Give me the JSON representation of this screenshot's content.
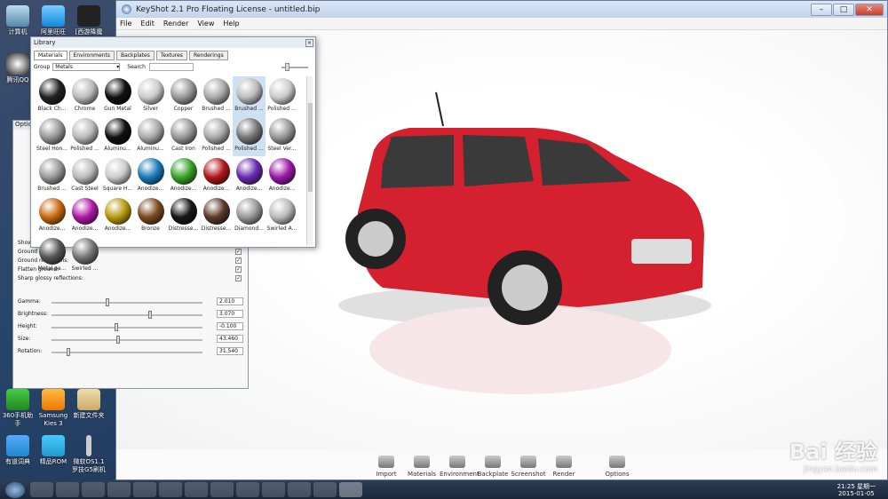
{
  "desktop": {
    "icons": [
      {
        "label": "计算机"
      },
      {
        "label": "阿里旺旺"
      },
      {
        "label": "[西游降魔篇]"
      },
      {
        "label": "腾讯QQ"
      },
      {
        "label": "360手机助手"
      },
      {
        "label": "Samsung Kies 3"
      },
      {
        "label": "新建文件夹"
      },
      {
        "label": "有道词典"
      },
      {
        "label": "精品ROM"
      },
      {
        "label": "微软OS1.1 罗技G5刷机"
      }
    ]
  },
  "window": {
    "title": "KeyShot 2.1 Pro Floating License - untitled.bip",
    "close": "✕"
  },
  "menu": [
    "File",
    "Edit",
    "Render",
    "View",
    "Help"
  ],
  "library": {
    "title": "Library",
    "tabs": [
      "Materials",
      "Environments",
      "Backplates",
      "Textures",
      "Renderings"
    ],
    "group_label": "Group",
    "group_value": "Metals",
    "search_label": "Search",
    "items": [
      {
        "name": "Black Ch...",
        "c": "#222"
      },
      {
        "name": "Chrome",
        "c": "#bbb"
      },
      {
        "name": "Gun Metal",
        "c": "#111"
      },
      {
        "name": "Silver",
        "c": "#ccc"
      },
      {
        "name": "Copper",
        "c": "#999"
      },
      {
        "name": "Brushed ...",
        "c": "#aaa"
      },
      {
        "name": "Brushed ...",
        "c": "#bbb",
        "hl": true
      },
      {
        "name": "Polished ...",
        "c": "#ccc"
      },
      {
        "name": "Steel Hon...",
        "c": "#999"
      },
      {
        "name": "Polished ...",
        "c": "#bbb"
      },
      {
        "name": "Aluminu...",
        "c": "#111"
      },
      {
        "name": "Aluminu...",
        "c": "#aaa"
      },
      {
        "name": "Cast Iron",
        "c": "#999"
      },
      {
        "name": "Polished ...",
        "c": "#aaa"
      },
      {
        "name": "Polished ...",
        "c": "#777",
        "hl": true
      },
      {
        "name": "Steel Ver...",
        "c": "#999"
      },
      {
        "name": "Brushed ...",
        "c": "#999"
      },
      {
        "name": "Cast Steel",
        "c": "#bbb"
      },
      {
        "name": "Square H...",
        "c": "#ccc"
      },
      {
        "name": "Anodize...",
        "c": "#1a7ab8"
      },
      {
        "name": "Anodize...",
        "c": "#3aa22a"
      },
      {
        "name": "Anodize...",
        "c": "#b01818"
      },
      {
        "name": "Anodize...",
        "c": "#6a2ab0"
      },
      {
        "name": "Anodize...",
        "c": "#9a1aa8"
      },
      {
        "name": "Anodize...",
        "c": "#c76a10"
      },
      {
        "name": "Anodize...",
        "c": "#b01aa8"
      },
      {
        "name": "Anodize...",
        "c": "#b89a10"
      },
      {
        "name": "Bronze",
        "c": "#7a4a22"
      },
      {
        "name": "Distresse...",
        "c": "#181818"
      },
      {
        "name": "Distresse...",
        "c": "#5a3a2a"
      },
      {
        "name": "Diamond...",
        "c": "#999"
      },
      {
        "name": "Swirled A...",
        "c": "#bbb"
      },
      {
        "name": "Metal pa...",
        "c": "#555"
      },
      {
        "name": "Swirled ...",
        "c": "#777"
      }
    ]
  },
  "options": {
    "title": "Optio",
    "checks": [
      {
        "label": "Show environment:",
        "checked": ""
      },
      {
        "label": "Ground shadows:",
        "checked": "✓"
      },
      {
        "label": "Ground reflections:",
        "checked": "✓"
      },
      {
        "label": "Flatten ground:",
        "checked": "✓"
      },
      {
        "label": "Sharp glossy reflections:",
        "checked": "✓"
      }
    ],
    "sliders": [
      {
        "label": "Gamma:",
        "value": "2.010",
        "pos": 0.36
      },
      {
        "label": "Brightness:",
        "value": "3.070",
        "pos": 0.64
      },
      {
        "label": "Height:",
        "value": "-0.100",
        "pos": 0.42
      },
      {
        "label": "Size:",
        "value": "43.460",
        "pos": 0.43
      },
      {
        "label": "Rotation:",
        "value": "31.540",
        "pos": 0.1
      }
    ]
  },
  "dock": [
    "Import",
    "Materials",
    "Environment",
    "Backplate",
    "Screenshot",
    "Render",
    "Options"
  ],
  "clock": {
    "time": "21:25 星期一",
    "date": "2015-01-05"
  },
  "watermark": {
    "main": "Bai 经验",
    "sub": "jingyan.baidu.com"
  },
  "colors": {
    "car": "#d4202f",
    "accent": "#2a5da8"
  }
}
